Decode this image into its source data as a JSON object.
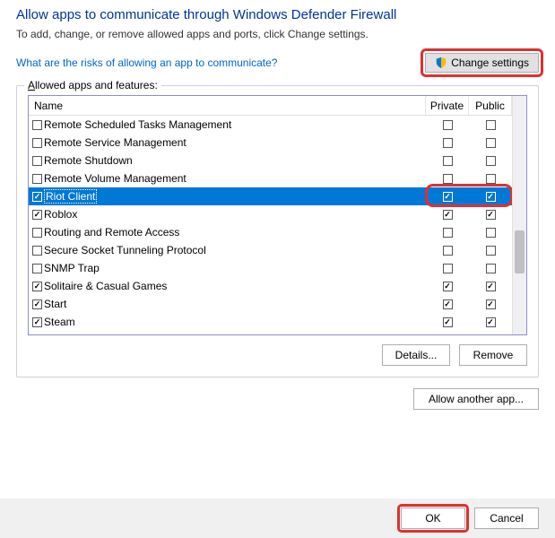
{
  "title": "Allow apps to communicate through Windows Defender Firewall",
  "subtitle": "To add, change, or remove allowed apps and ports, click Change settings.",
  "riskLink": "What are the risks of allowing an app to communicate?",
  "changeSettingsLabel": "Change settings",
  "groupLabel": "Allowed apps and features:",
  "columns": {
    "name": "Name",
    "private": "Private",
    "public": "Public"
  },
  "apps": [
    {
      "name": "Remote Scheduled Tasks Management",
      "enabled": false,
      "private": false,
      "public": false,
      "selected": false
    },
    {
      "name": "Remote Service Management",
      "enabled": false,
      "private": false,
      "public": false,
      "selected": false
    },
    {
      "name": "Remote Shutdown",
      "enabled": false,
      "private": false,
      "public": false,
      "selected": false
    },
    {
      "name": "Remote Volume Management",
      "enabled": false,
      "private": false,
      "public": false,
      "selected": false
    },
    {
      "name": "Riot Client",
      "enabled": true,
      "private": true,
      "public": true,
      "selected": true
    },
    {
      "name": "Roblox",
      "enabled": true,
      "private": true,
      "public": true,
      "selected": false
    },
    {
      "name": "Routing and Remote Access",
      "enabled": false,
      "private": false,
      "public": false,
      "selected": false
    },
    {
      "name": "Secure Socket Tunneling Protocol",
      "enabled": false,
      "private": false,
      "public": false,
      "selected": false
    },
    {
      "name": "SNMP Trap",
      "enabled": false,
      "private": false,
      "public": false,
      "selected": false
    },
    {
      "name": "Solitaire & Casual Games",
      "enabled": true,
      "private": true,
      "public": true,
      "selected": false
    },
    {
      "name": "Start",
      "enabled": true,
      "private": true,
      "public": true,
      "selected": false
    },
    {
      "name": "Steam",
      "enabled": true,
      "private": true,
      "public": true,
      "selected": false
    }
  ],
  "buttons": {
    "details": "Details...",
    "remove": "Remove",
    "allowAnother": "Allow another app...",
    "ok": "OK",
    "cancel": "Cancel"
  }
}
